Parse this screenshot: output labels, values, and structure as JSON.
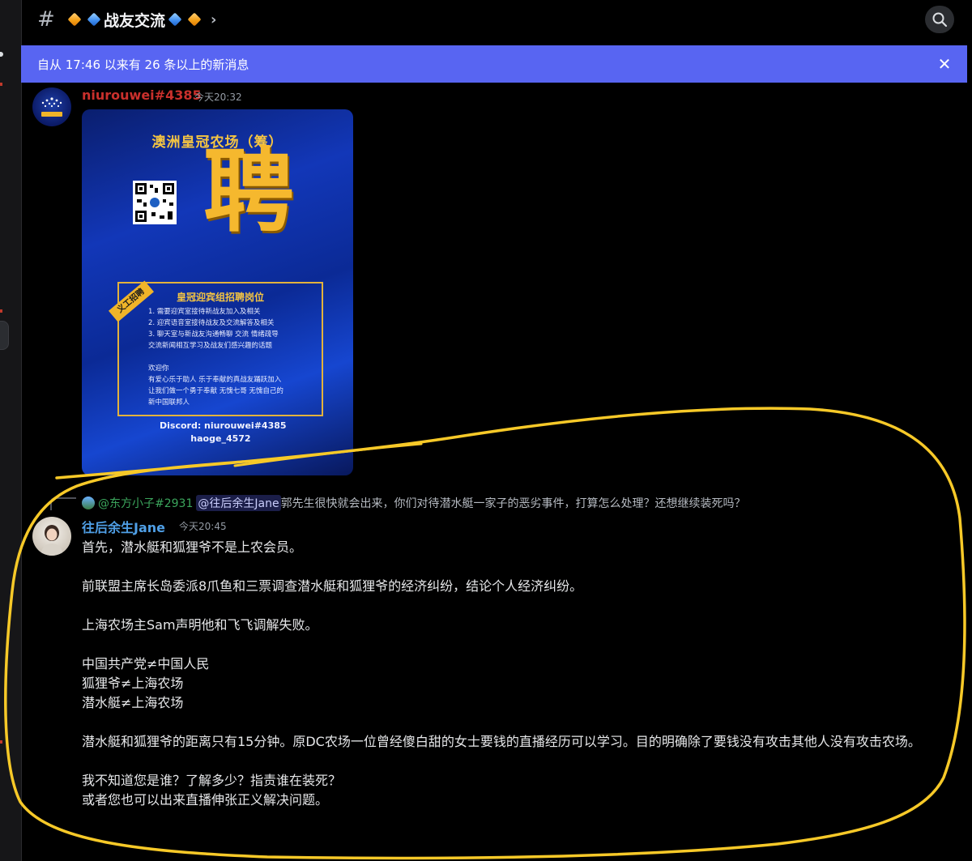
{
  "header": {
    "channel_name": "战友交流",
    "chevron": "›",
    "hash": "#"
  },
  "new_messages_bar": {
    "text": "自从 17:46 以来有 26 条以上的新消息",
    "close": "✕"
  },
  "messages": [
    {
      "username": "niurouwei#4385",
      "timestamp": "今天20:32",
      "username_color": "#c9302c",
      "poster": {
        "title": "澳洲皇冠农场（筹）",
        "big_char": "聘",
        "ribbon": "义工招聘",
        "box_title": "皇冠迎宾组招聘岗位",
        "box_lines": "1. 需要迎宾室接待新战友加入及相关\n2. 迎宾语音室接待战友及交流解答及相关\n3. 聊天室与新战友沟通畅聊 交流 情绪疏导\n交流新闻相互学习及战友们感兴趣的话题\n\n欢迎你\n有爱心乐于助人 乐于奉献的真战友踊跃加入\n让我们做一个勇于奉献 无愧七哥 无愧自己的\n新中国联邦人",
        "discord": "Discord: niurouwei#4385\n          haoge_4572"
      }
    },
    {
      "reply": {
        "name": "@东方小子#2931",
        "mention": "@往后余生Jane",
        "text": "郭先生很快就会出来，你们对待潜水艇一家子的恶劣事件，打算怎么处理？还想继续装死吗？"
      },
      "username": "往后余生Jane",
      "timestamp": "今天20:45",
      "username_color": "#4f9fe6",
      "paragraphs": [
        "首先，潜水艇和狐狸爷不是上农会员。",
        "前联盟主席长岛委派8爪鱼和三票调查潜水艇和狐狸爷的经济纠纷，结论个人经济纠纷。",
        "上海农场主Sam声明他和飞飞调解失败。",
        "中国共产党≠中国人民",
        "狐狸爷≠上海农场",
        "潜水艇≠上海农场",
        "潜水艇和狐狸爷的距离只有15分钟。原DC农场一位曾经傻白甜的女士要钱的直播经历可以学习。目的明确除了要钱没有攻击其他人没有攻击农场。",
        "我不知道您是谁？了解多少？指责谁在装死？",
        "或者您也可以出来直播伸张正义解决问题。"
      ]
    }
  ],
  "colors": {
    "new_bar": "#5865f2",
    "annotation_circle": "#f7c928"
  },
  "icons": [
    "hash-icon",
    "diamond-icon",
    "search-icon",
    "close-icon",
    "chevron-right-icon"
  ]
}
